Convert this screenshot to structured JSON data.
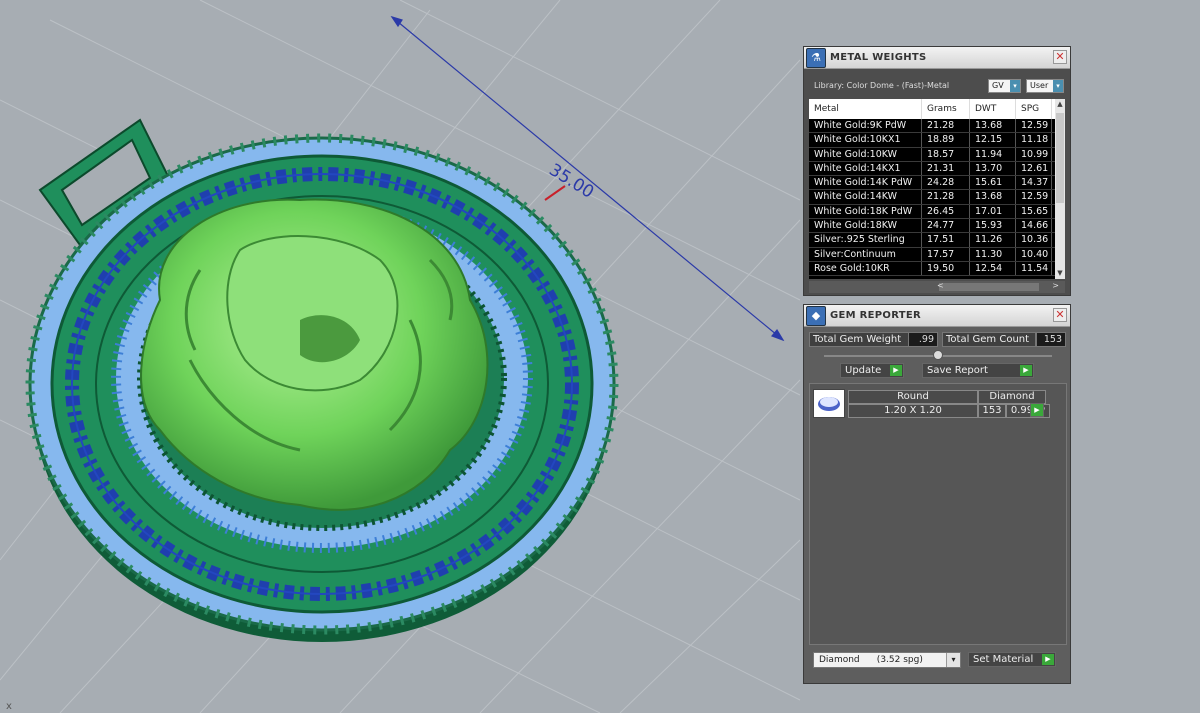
{
  "viewport": {
    "dimension_value": "35.00",
    "axis_marker": "x",
    "colors": {
      "background": "#a7adb3",
      "grid": "#bcc1c6",
      "pendant_green": "#1f8f5c",
      "greek_key": "#1f3fae",
      "gems": "#86b8ee",
      "lion": "#7fdc6a",
      "dimension": "#2b3aa8"
    }
  },
  "metal_weights": {
    "title": "METAL WEIGHTS",
    "icon": "flask-icon",
    "library_label": "Library: Color Dome - (Fast)-Metal",
    "gv_select": "GV",
    "user_select": "User",
    "columns": [
      "Metal",
      "Grams",
      "DWT",
      "SPG"
    ],
    "rows": [
      [
        "White Gold:9K PdW",
        "21.28",
        "13.68",
        "12.59"
      ],
      [
        "White Gold:10KX1",
        "18.89",
        "12.15",
        "11.18"
      ],
      [
        "White Gold:10KW",
        "18.57",
        "11.94",
        "10.99"
      ],
      [
        "White Gold:14KX1",
        "21.31",
        "13.70",
        "12.61"
      ],
      [
        "White Gold:14K PdW",
        "24.28",
        "15.61",
        "14.37"
      ],
      [
        "White Gold:14KW",
        "21.28",
        "13.68",
        "12.59"
      ],
      [
        "White Gold:18K PdW",
        "26.45",
        "17.01",
        "15.65"
      ],
      [
        "White Gold:18KW",
        "24.77",
        "15.93",
        "14.66"
      ],
      [
        "Silver:.925 Sterling",
        "17.51",
        "11.26",
        "10.36"
      ],
      [
        "Silver:Continuum",
        "17.57",
        "11.30",
        "10.40"
      ],
      [
        "Rose Gold:10KR",
        "19.50",
        "12.54",
        "11.54"
      ]
    ]
  },
  "gem_reporter": {
    "title": "GEM REPORTER",
    "icon": "gem-report-icon",
    "total_weight_label": "Total Gem Weight",
    "total_weight_value": ".99",
    "total_count_label": "Total Gem Count",
    "total_count_value": "153",
    "update_label": "Update",
    "save_label": "Save Report",
    "gem": {
      "shape": "Round",
      "size": "1.20 X 1.20",
      "material": "Diamond",
      "count": "153",
      "weight": "0.99tw"
    },
    "material_select": "Diamond      (3.52 spg)",
    "set_material_label": "Set Material"
  }
}
